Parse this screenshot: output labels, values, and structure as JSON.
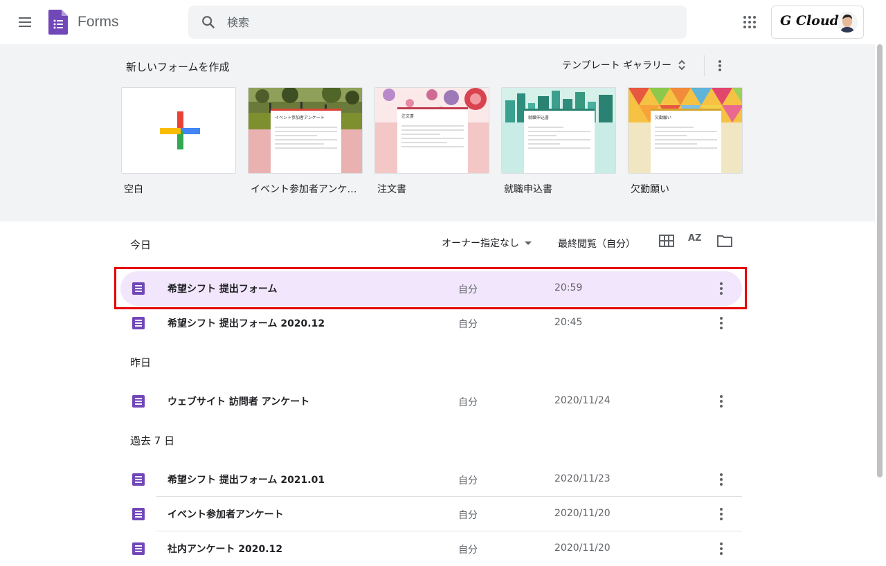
{
  "header": {
    "app_name": "Forms",
    "search_placeholder": "検索",
    "account_label": "G Cloud"
  },
  "templates": {
    "title": "新しいフォームを作成",
    "gallery_label": "テンプレート ギャラリー",
    "items": [
      {
        "label": "空白"
      },
      {
        "label": "イベント参加者アンケート",
        "preview_title": "イベント参加者アンケート"
      },
      {
        "label": "注文書",
        "preview_title": "注文書"
      },
      {
        "label": "就職申込書",
        "preview_title": "就職申込書"
      },
      {
        "label": "欠勤願い",
        "preview_title": "欠勤願い"
      }
    ]
  },
  "list": {
    "owner_filter": "オーナー指定なし",
    "sort_label": "最終閲覧（自分）",
    "sort_icon": "AZ",
    "sections": [
      {
        "label": "今日"
      },
      {
        "label": "昨日"
      },
      {
        "label": "過去 7 日"
      }
    ],
    "rows": [
      {
        "name": "希望シフト 提出フォーム",
        "owner": "自分",
        "date": "20:59",
        "selected": true
      },
      {
        "name": "希望シフト 提出フォーム 2020.12",
        "owner": "自分",
        "date": "20:45"
      },
      {
        "name": "ウェブサイト 訪問者 アンケート",
        "owner": "自分",
        "date": "2020/11/24"
      },
      {
        "name": "希望シフト 提出フォーム 2021.01",
        "owner": "自分",
        "date": "2020/11/23"
      },
      {
        "name": "イベント参加者アンケート",
        "owner": "自分",
        "date": "2020/11/20"
      },
      {
        "name": "社内アンケート 2020.12",
        "owner": "自分",
        "date": "2020/11/20"
      }
    ]
  },
  "colors": {
    "forms_purple": "#7248b9",
    "selected_row": "#f1e6fb",
    "highlight": "#e50000"
  }
}
